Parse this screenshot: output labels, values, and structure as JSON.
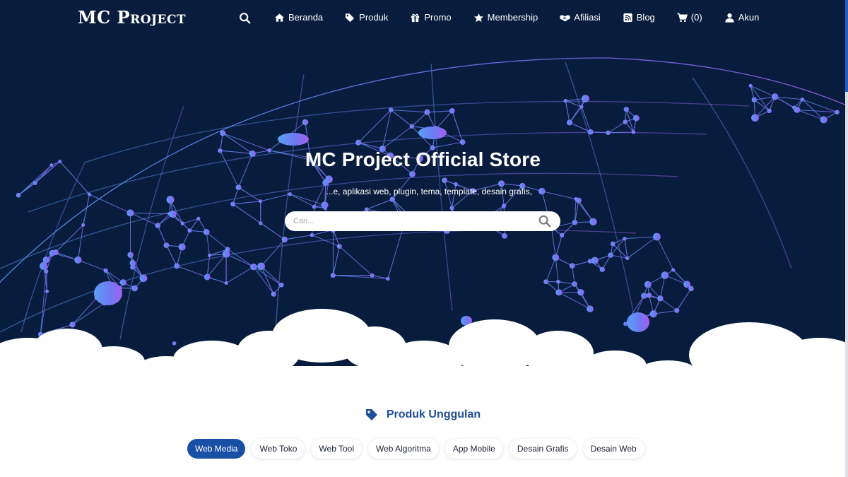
{
  "brand": {
    "logo_text": "MC Project"
  },
  "nav": {
    "items": [
      {
        "label": "Beranda",
        "icon": "home-icon"
      },
      {
        "label": "Produk",
        "icon": "tags-icon"
      },
      {
        "label": "Promo",
        "icon": "gift-icon"
      },
      {
        "label": "Membership",
        "icon": "star-icon"
      },
      {
        "label": "Afiliasi",
        "icon": "handshake-icon"
      },
      {
        "label": "Blog",
        "icon": "rss-icon"
      },
      {
        "label": "(0)",
        "icon": "cart-icon"
      },
      {
        "label": "Akun",
        "icon": "user-icon"
      }
    ]
  },
  "hero": {
    "title": "MC Project Official Store",
    "subtitle": "...e, aplikasi web, plugin, tema, template, desain grafis,",
    "search_placeholder": "Cari..."
  },
  "featured": {
    "title": "Produk Unggulan",
    "icon": "tag-icon",
    "tabs": [
      {
        "label": "Web Media",
        "active": true
      },
      {
        "label": "Web Toko",
        "active": false
      },
      {
        "label": "Web Tool",
        "active": false
      },
      {
        "label": "Web Algoritma",
        "active": false
      },
      {
        "label": "App Mobile",
        "active": false
      },
      {
        "label": "Desain Grafis",
        "active": false
      },
      {
        "label": "Desain Web",
        "active": false
      }
    ]
  },
  "colors": {
    "hero_bg": "#081d3e",
    "network_blue": "#5b8cf5",
    "network_purple": "#9b5cf2",
    "accent": "#1a4fa6",
    "section_title": "#1e4f9c"
  }
}
